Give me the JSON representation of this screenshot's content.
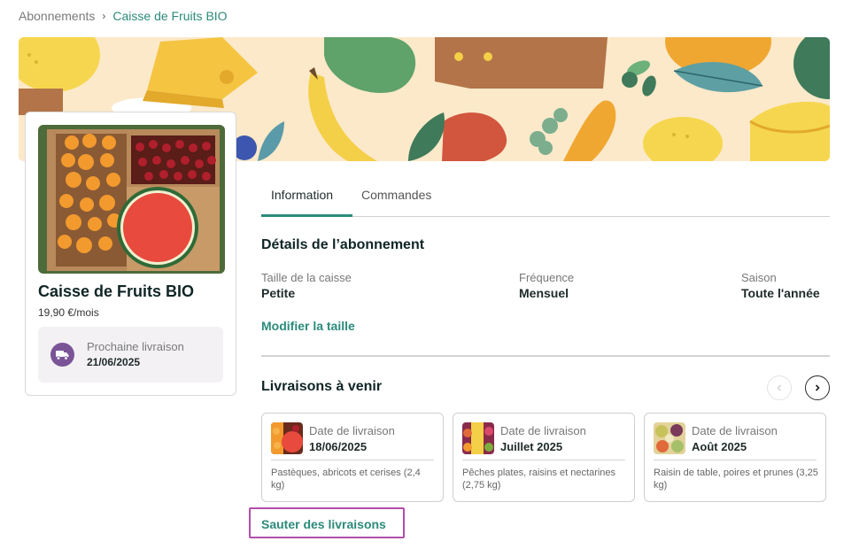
{
  "breadcrumb": {
    "parent": "Abonnements",
    "separator": "›",
    "current": "Caisse de Fruits BIO"
  },
  "product": {
    "name": "Caisse de Fruits BIO",
    "price": "19,90 €/mois",
    "next_delivery_label": "Prochaine livraison",
    "next_delivery_date": "21/06/2025"
  },
  "tabs": [
    {
      "label": "Information",
      "active": true
    },
    {
      "label": "Commandes",
      "active": false
    }
  ],
  "details": {
    "title": "Détails de l’abonnement",
    "fields": [
      {
        "label": "Taille de la caisse",
        "value": "Petite"
      },
      {
        "label": "Fréquence",
        "value": "Mensuel"
      },
      {
        "label": "Saison",
        "value": "Toute l'année"
      }
    ],
    "modify_label": "Modifier la taille"
  },
  "upcoming": {
    "title": "Livraisons à venir",
    "prev_icon": "chevron-left-icon",
    "next_icon": "chevron-right-icon",
    "deliveries": [
      {
        "label": "Date de livraison",
        "date": "18/06/2025",
        "desc": "Pastèques, abricots et cerises (2,4 kg)"
      },
      {
        "label": "Date de livraison",
        "date": "Juillet 2025",
        "desc": "Pêches plates, raisins et nectarines (2,75 kg)"
      },
      {
        "label": "Date de livraison",
        "date": "Août 2025",
        "desc": "Raisin de table, poires et prunes (3,25 kg)"
      }
    ],
    "skip_label": "Sauter des livraisons"
  },
  "colors": {
    "accent": "#2b8b7b",
    "truck_badge": "#7a5497",
    "highlight": "#b04fa9",
    "banner_bg": "#fbe9c9"
  }
}
